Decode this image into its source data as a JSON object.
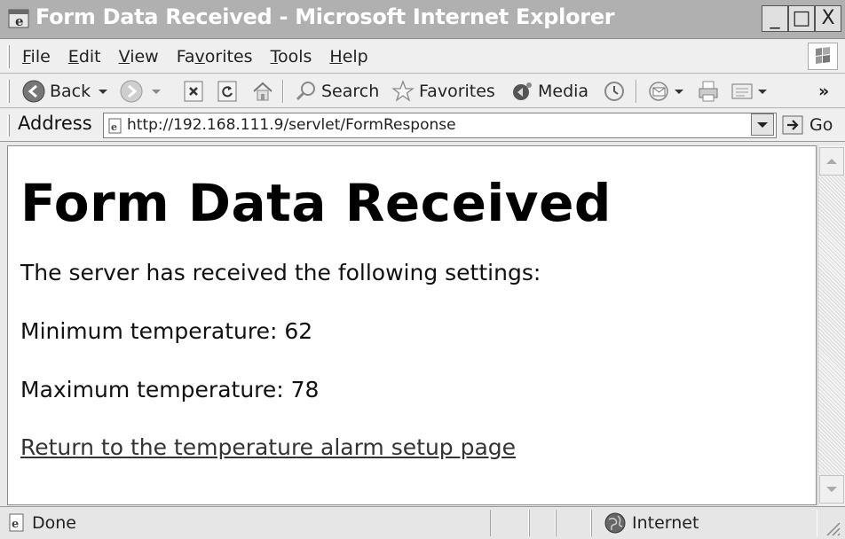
{
  "window": {
    "title": "Form Data Received - Microsoft Internet Explorer",
    "minimize": "_",
    "maximize": "□",
    "close": "X"
  },
  "menu": {
    "items": [
      {
        "first": "F",
        "rest": "ile"
      },
      {
        "first": "E",
        "rest": "dit"
      },
      {
        "first": "V",
        "rest": "iew"
      },
      {
        "first": "Fa",
        "u": "v",
        "rest": "orites"
      },
      {
        "first": "T",
        "rest": "ools"
      },
      {
        "first": "H",
        "rest": "elp"
      }
    ]
  },
  "toolbar": {
    "back_label": "Back",
    "search_label": "Search",
    "favorites_label": "Favorites",
    "media_label": "Media",
    "overflow": "»"
  },
  "address": {
    "label": "Address",
    "url": "http://192.168.111.9/servlet/FormResponse",
    "go_label": "Go"
  },
  "page": {
    "heading": "Form Data Received",
    "intro": "The server has received the following settings:",
    "min_label": "Minimum temperature: 62",
    "max_label": "Maximum temperature: 78",
    "return_link": "Return to the temperature alarm setup page"
  },
  "status": {
    "text": "Done",
    "zone": "Internet"
  },
  "icons": [
    "ie-app-icon",
    "back-arrow-icon",
    "forward-arrow-icon",
    "stop-icon",
    "refresh-icon",
    "home-icon",
    "search-icon",
    "favorites-star-icon",
    "media-icon",
    "history-icon",
    "mail-icon",
    "print-icon",
    "edit-icon",
    "page-icon",
    "go-arrow-icon",
    "globe-icon",
    "windows-flag-icon"
  ]
}
